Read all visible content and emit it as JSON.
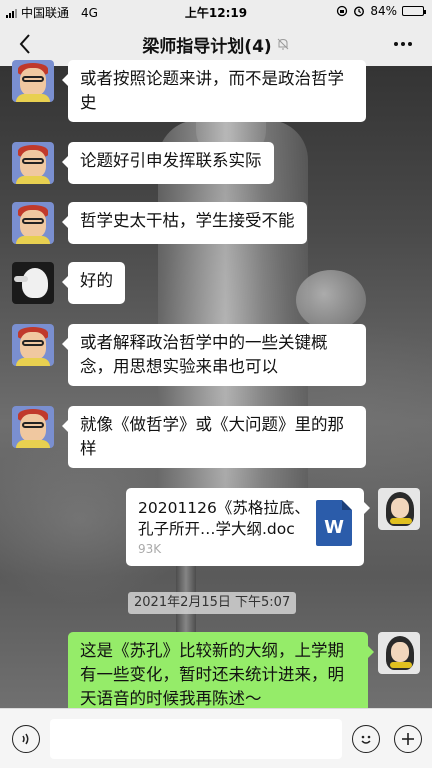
{
  "status_bar": {
    "carrier": "中国联通",
    "network": "4G",
    "time": "上午12:19",
    "battery": "84%",
    "battery_level": 0.84
  },
  "nav": {
    "title": "梁师指导计划(4)",
    "back_icon": "chevron-left-icon",
    "mute_icon": "bell-off-icon",
    "more_icon": "more-dots-icon"
  },
  "messages": [
    {
      "side": "left",
      "avatar": "boy",
      "text": "或者按照论题来讲，而不是政治哲学史"
    },
    {
      "side": "left",
      "avatar": "boy",
      "text": "论题好引申发挥联系实际"
    },
    {
      "side": "left",
      "avatar": "boy",
      "text": "哲学史太干枯，学生接受不能"
    },
    {
      "side": "left",
      "avatar": "bird",
      "text": "好的"
    },
    {
      "side": "left",
      "avatar": "boy",
      "text": "或者解释政治哲学中的一些关键概念，用思想实验来串也可以"
    },
    {
      "side": "left",
      "avatar": "boy",
      "text": "就像《做哲学》或《大问题》里的那样"
    },
    {
      "side": "right",
      "avatar": "girl",
      "type": "file",
      "file_name": "20201126《苏格拉底、孔子所开…学大纲.doc",
      "file_size": "93K",
      "file_type_label": "W"
    },
    {
      "side": "right",
      "avatar": "girl",
      "text": "这是《苏孔》比较新的大纲，上学期有一些变化，暂时还未统计进来，明天语音的时候我再陈述～"
    }
  ],
  "timestamp": "2021年2月15日 下午5:07",
  "colors": {
    "bar_bg": "#ededed",
    "bubble_white": "#ffffff",
    "bubble_green": "#95ec69",
    "word_blue": "#2b5caa"
  },
  "input_bar": {
    "voice_icon": "voice-icon",
    "emoji_icon": "emoji-icon",
    "plus_icon": "plus-icon"
  }
}
